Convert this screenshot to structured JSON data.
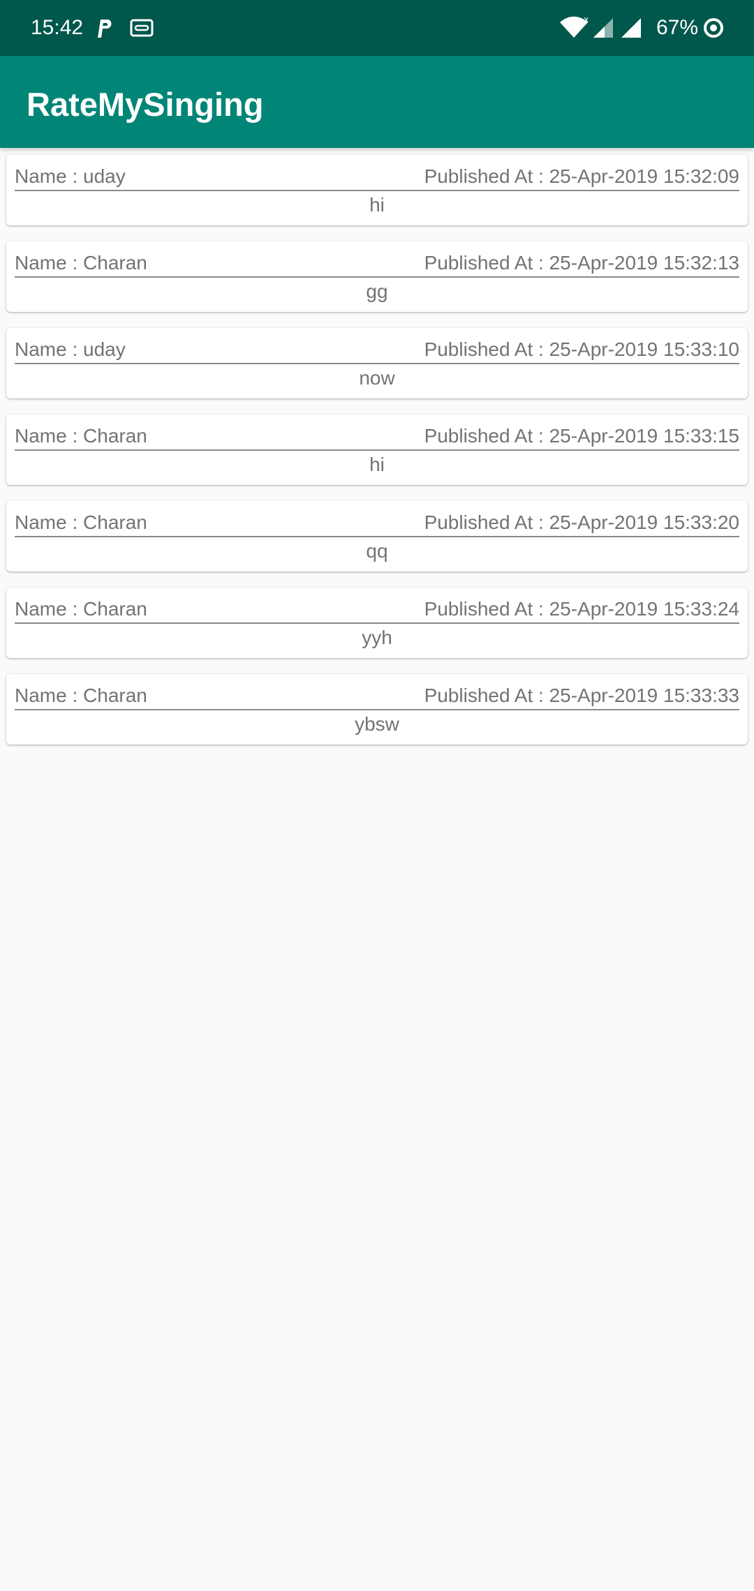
{
  "status_bar": {
    "time": "15:42",
    "battery": "67%",
    "icons": [
      "parking-icon",
      "voicemail-icon",
      "wifi-icon",
      "signal-icon",
      "signal-icon",
      "battery-saver-icon"
    ]
  },
  "app_bar": {
    "title": "RateMySinging",
    "color": "#008577"
  },
  "messages": [
    {
      "name": "Name : uday",
      "published": "Published At : 25-Apr-2019 15:32:09",
      "text": "hi"
    },
    {
      "name": "Name : Charan",
      "published": "Published At : 25-Apr-2019 15:32:13",
      "text": "gg"
    },
    {
      "name": "Name : uday",
      "published": "Published At : 25-Apr-2019 15:33:10",
      "text": "now"
    },
    {
      "name": "Name : Charan",
      "published": "Published At : 25-Apr-2019 15:33:15",
      "text": "hi"
    },
    {
      "name": "Name : Charan",
      "published": "Published At : 25-Apr-2019 15:33:20",
      "text": "qq"
    },
    {
      "name": "Name : Charan",
      "published": "Published At : 25-Apr-2019 15:33:24",
      "text": "yyh"
    },
    {
      "name": "Name : Charan",
      "published": "Published At : 25-Apr-2019 15:33:33",
      "text": "ybsw"
    }
  ]
}
